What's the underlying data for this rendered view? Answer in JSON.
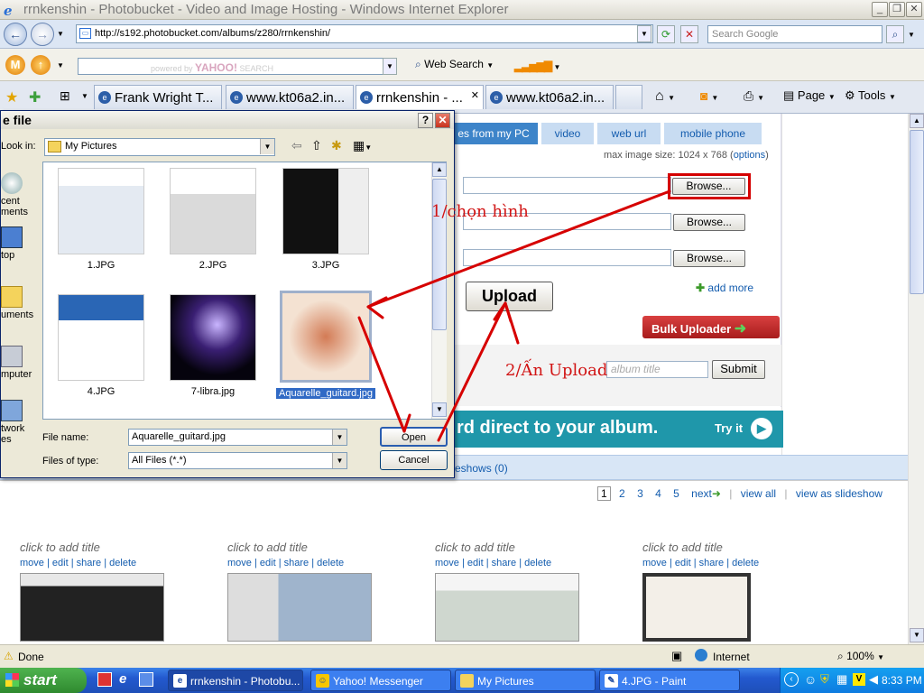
{
  "window": {
    "title": "rrnkenshin - Photobucket - Video and Image Hosting - Windows Internet Explorer"
  },
  "address": {
    "url": "http://s192.photobucket.com/albums/z280/rrnkenshin/",
    "search_placeholder": "Search Google"
  },
  "yahoo": {
    "logo": "YAHOO!",
    "search_label": "SEARCH",
    "powered_by": "powered by",
    "web_search": "Web Search"
  },
  "tabs": [
    {
      "label": "Frank Wright T..."
    },
    {
      "label": "www.kt06a2.in..."
    },
    {
      "label": "rrnkenshin - ..."
    },
    {
      "label": "www.kt06a2.in..."
    }
  ],
  "toolbar": {
    "page": "Page",
    "tools": "Tools"
  },
  "upload": {
    "tabs": [
      "es from my PC",
      "video",
      "web url",
      "mobile phone"
    ],
    "max_size_prefix": "max image size: 1024 x 768 (",
    "max_size_link": "options",
    "max_size_suffix": ")",
    "browse": "Browse...",
    "upload_button": "Upload",
    "add_more": "add more",
    "bulk_uploader": "Bulk Uploader",
    "album_title_placeholder": "album title",
    "submit": "Submit",
    "banner_text": "rd direct to your album.",
    "banner_try": "Try it"
  },
  "annotations": {
    "choose": "1/chọn hình",
    "press_upload": "2/Ấn Upload"
  },
  "album": {
    "slideshows": "eshows (0)",
    "pages": [
      "1",
      "2",
      "3",
      "4",
      "5"
    ],
    "next": "next",
    "view_all": "view all",
    "view_slideshow": "view as slideshow",
    "items": [
      {
        "title": "click to add title",
        "actions": [
          "move",
          "edit",
          "share",
          "delete"
        ]
      },
      {
        "title": "click to add title",
        "actions": [
          "move",
          "edit",
          "share",
          "delete"
        ]
      },
      {
        "title": "click to add title",
        "actions": [
          "move",
          "edit",
          "share",
          "delete"
        ]
      },
      {
        "title": "click to add title",
        "actions": [
          "move",
          "edit",
          "share",
          "delete"
        ]
      }
    ]
  },
  "dialog": {
    "title": "e file",
    "look_in_label": "Look in:",
    "look_in_value": "My Pictures",
    "places": [
      "cent\nments",
      "top",
      "uments",
      "mputer",
      "twork\nes"
    ],
    "files": [
      {
        "name": "1.JPG"
      },
      {
        "name": "2.JPG"
      },
      {
        "name": "3.JPG"
      },
      {
        "name": "4.JPG"
      },
      {
        "name": "7-libra.jpg"
      },
      {
        "name": "Aquarelle_guitard.jpg"
      }
    ],
    "file_name_label": "File name:",
    "file_name_value": "Aquarelle_guitard.jpg",
    "files_of_type_label": "Files of type:",
    "files_of_type_value": "All Files (*.*)",
    "open": "Open",
    "cancel": "Cancel"
  },
  "status": {
    "text": "Done",
    "zone": "Internet",
    "zoom": "100%"
  },
  "taskbar": {
    "start": "start",
    "tasks": [
      {
        "label": "rrnkenshin - Photobu..."
      },
      {
        "label": "Yahoo! Messenger"
      },
      {
        "label": "My Pictures"
      },
      {
        "label": "4.JPG - Paint"
      }
    ],
    "clock": "8:33 PM"
  }
}
